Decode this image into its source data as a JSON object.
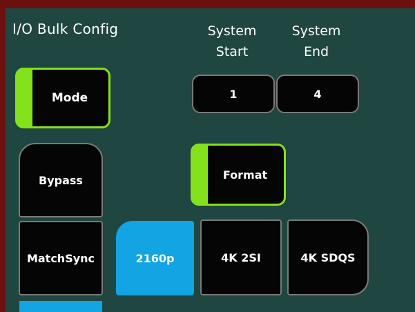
{
  "panel": {
    "title": "I/O Bulk Config"
  },
  "headers": {
    "system_start": [
      "System",
      "Start"
    ],
    "system_end": [
      "System",
      "End"
    ]
  },
  "fields": {
    "system_start_value": "1",
    "system_end_value": "4"
  },
  "buttons": {
    "mode": "Mode",
    "format": "Format",
    "bypass": "Bypass",
    "matchsync": "MatchSync",
    "res_2160p": "2160p",
    "fmt_4k_2si": "4K 2SI",
    "fmt_4k_sdqs": "4K SDQS"
  },
  "colors": {
    "panel_bg": "#1f4640",
    "frame": "#6e0f0f",
    "active_green": "#84e21c",
    "selected_blue": "#12a4e3"
  }
}
